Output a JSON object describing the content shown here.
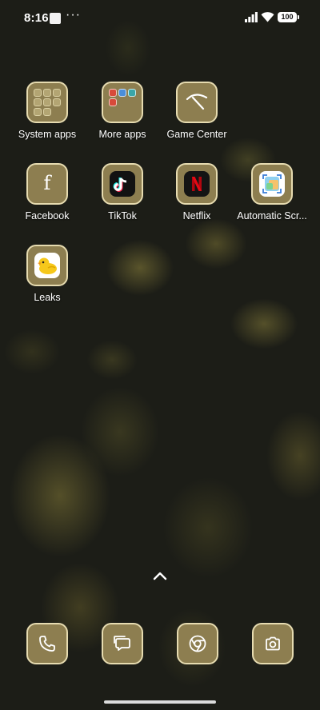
{
  "status_bar": {
    "time": "8:16",
    "overflow": "···",
    "battery": "100",
    "icons": [
      "notification-square-icon",
      "signal-icon",
      "wifi-icon",
      "battery-icon"
    ]
  },
  "apps": {
    "system_apps": "System apps",
    "more_apps": "More apps",
    "game_center": "Game Center",
    "facebook": "Facebook",
    "tiktok": "TikTok",
    "netflix": "Netflix",
    "automatic_screenshot": "Automatic Scr...",
    "leaks": "Leaks"
  },
  "dock": {
    "icons": [
      "phone-icon",
      "messages-icon",
      "chrome-icon",
      "camera-icon"
    ]
  },
  "theme": {
    "tile_fill": "#8d7e50",
    "tile_border": "#e6dbb0",
    "wallpaper": "#1c1d17"
  }
}
